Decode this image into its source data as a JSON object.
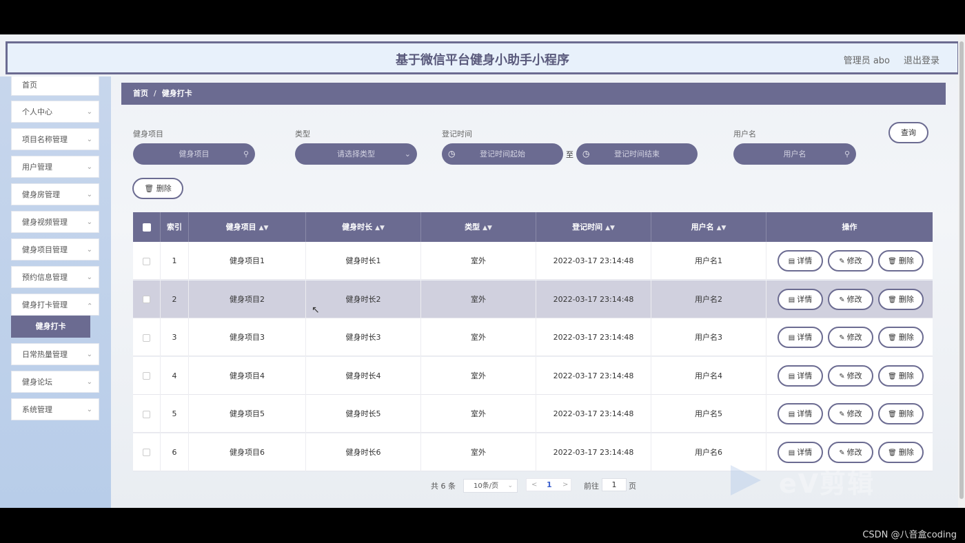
{
  "header": {
    "title": "基于微信平台健身小助手小程序",
    "admin": "管理员 abo",
    "logout": "退出登录"
  },
  "sidebar": {
    "items": [
      {
        "label": "首页",
        "chevron": false
      },
      {
        "label": "个人中心",
        "chevron": true
      },
      {
        "label": "项目名称管理",
        "chevron": true
      },
      {
        "label": "用户管理",
        "chevron": true
      },
      {
        "label": "健身房管理",
        "chevron": true
      },
      {
        "label": "健身视频管理",
        "chevron": true
      },
      {
        "label": "健身项目管理",
        "chevron": true
      },
      {
        "label": "预约信息管理",
        "chevron": true
      },
      {
        "label": "健身打卡管理",
        "chevron": true
      },
      {
        "label": "日常热量管理",
        "chevron": true
      },
      {
        "label": "健身论坛",
        "chevron": true
      },
      {
        "label": "系统管理",
        "chevron": true
      }
    ],
    "sub_active": "健身打卡",
    "chevron_glyph": "⌄"
  },
  "breadcrumb": {
    "home": "首页",
    "sep": "/",
    "current": "健身打卡"
  },
  "filters": {
    "project_label": "健身项目",
    "project_placeholder": "健身项目",
    "type_label": "类型",
    "type_placeholder": "请选择类型",
    "time_label": "登记时间",
    "time_start": "登记时间起始",
    "time_sep": "至",
    "time_end": "登记时间结束",
    "user_label": "用户名",
    "user_placeholder": "用户名",
    "query": "查询",
    "delete": "删除"
  },
  "table": {
    "columns": [
      "索引",
      "健身项目",
      "健身时长",
      "类型",
      "登记时间",
      "用户名",
      "操作"
    ],
    "rows": [
      {
        "index": "1",
        "project": "健身项目1",
        "duration": "健身时长1",
        "type": "室外",
        "time": "2022-03-17 23:14:48",
        "user": "用户名1"
      },
      {
        "index": "2",
        "project": "健身项目2",
        "duration": "健身时长2",
        "type": "室外",
        "time": "2022-03-17 23:14:48",
        "user": "用户名2"
      },
      {
        "index": "3",
        "project": "健身项目3",
        "duration": "健身时长3",
        "type": "室外",
        "time": "2022-03-17 23:14:48",
        "user": "用户名3"
      },
      {
        "index": "4",
        "project": "健身项目4",
        "duration": "健身时长4",
        "type": "室外",
        "time": "2022-03-17 23:14:48",
        "user": "用户名4"
      },
      {
        "index": "5",
        "project": "健身项目5",
        "duration": "健身时长5",
        "type": "室外",
        "time": "2022-03-17 23:14:48",
        "user": "用户名5"
      },
      {
        "index": "6",
        "project": "健身项目6",
        "duration": "健身时长6",
        "type": "室外",
        "time": "2022-03-17 23:14:48",
        "user": "用户名6"
      }
    ],
    "highlighted_row": 2,
    "actions": {
      "detail": "详情",
      "edit": "修改",
      "delete": "删除"
    }
  },
  "pagination": {
    "total": "共 6 条",
    "page_size": "10条/页",
    "current": "1",
    "goto_prefix": "前往",
    "goto_value": "1",
    "goto_suffix": "页"
  },
  "watermark": "eV剪辑",
  "csdn": "CSDN @八音盒coding",
  "colors": {
    "accent": "#6b6b91",
    "header_bg": "#e8f1fb",
    "sidebar_bg": "#c7d6ec",
    "row_highlight": "#d0d0de"
  }
}
